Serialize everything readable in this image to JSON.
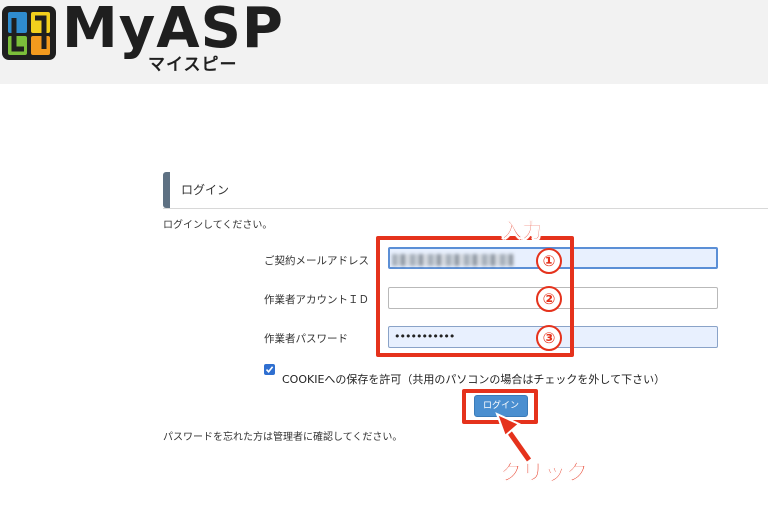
{
  "brand": {
    "name": "MyASP",
    "kana": "マイスピー",
    "colors": {
      "blue": "#2f8ccf",
      "green": "#7bbf3a",
      "orange": "#f39a1e",
      "yellow": "#f2cf1d",
      "dark": "#1f1f1f"
    }
  },
  "panel": {
    "title": "ログイン",
    "intro": "ログインしてください。"
  },
  "form": {
    "email": {
      "label": "ご契約メールアドレス",
      "value": ""
    },
    "account_id": {
      "label": "作業者アカウントＩＤ",
      "value": ""
    },
    "password": {
      "label": "作業者パスワード",
      "value": "•••••••••••"
    },
    "cookie": {
      "label": "COOKIEへの保存を許可（共用のパソコンの場合はチェックを外して下さい）",
      "checked": true
    },
    "submit_label": "ログイン"
  },
  "forgot_text": "パスワードを忘れた方は管理者に確認してください。",
  "annotations": {
    "input_label": "入力",
    "click_label": "クリック",
    "num1": "①",
    "num2": "②",
    "num3": "③",
    "color": "#e5321c"
  }
}
